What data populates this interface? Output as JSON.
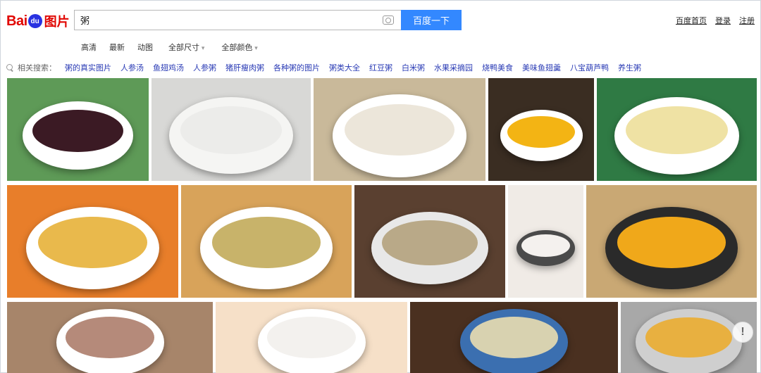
{
  "logo": {
    "bai": "Bai",
    "du": "du",
    "pic": "图片"
  },
  "search": {
    "query": "粥",
    "button": "百度一下"
  },
  "toplinks": [
    "百度首页",
    "登录",
    "注册"
  ],
  "filters": [
    "高清",
    "最新",
    "动图",
    "全部尺寸",
    "全部颜色"
  ],
  "related": {
    "label": "相关搜索：",
    "terms": [
      "粥的真实图片",
      "人参汤",
      "鱼翅鸡汤",
      "人参粥",
      "猪肝瘦肉粥",
      "各种粥的图片",
      "粥类大全",
      "红豆粥",
      "白米粥",
      "水果采摘园",
      "烧鸭美食",
      "美味鱼翅羹",
      "八宝葫芦鸭",
      "养生粥"
    ]
  },
  "help": "!",
  "images": [
    {
      "name": "black-rice-porridge",
      "bg": "#5e9a57",
      "bowl": "#ffffff",
      "food": "#3b1a24"
    },
    {
      "name": "white-rice-porridge",
      "bg": "#d8d8d6",
      "bowl": "#f5f5f3",
      "food": "#ececea"
    },
    {
      "name": "mushroom-rice-porridge",
      "bg": "#c9b99a",
      "bowl": "#ffffff",
      "food": "#ece6da"
    },
    {
      "name": "millet-date-porridge",
      "bg": "#3a2d22",
      "bowl": "#ffffff",
      "food": "#f3b414"
    },
    {
      "name": "yellow-millet-porridge",
      "bg": "#2f7a44",
      "bowl": "#ffffff",
      "food": "#efe2a4"
    },
    {
      "name": "corn-porridge",
      "bg": "#e87e2a",
      "bowl": "#ffffff",
      "food": "#e9b94c"
    },
    {
      "name": "seafood-congee",
      "bg": "#d8a35a",
      "bowl": "#ffffff",
      "food": "#c8b36a"
    },
    {
      "name": "grain-porridge",
      "bg": "#5a4030",
      "bowl": "#e8e8e8",
      "food": "#b9a988"
    },
    {
      "name": "date-milk-porridge",
      "bg": "#f0ebe6",
      "bowl": "#4a4a4a",
      "food": "#f4f1ee"
    },
    {
      "name": "pumpkin-millet-porridge",
      "bg": "#c9a874",
      "bowl": "#2a2a2a",
      "food": "#f0a81a"
    },
    {
      "name": "mixed-bean-porridge",
      "bg": "#a7856a",
      "bowl": "#ffffff",
      "food": "#b58a7a"
    },
    {
      "name": "fruit-porridge",
      "bg": "#f6e0c8",
      "bowl": "#ffffff",
      "food": "#f3f1ee"
    },
    {
      "name": "mung-bean-porridge",
      "bg": "#4a3020",
      "bowl": "#3b6fb0",
      "food": "#d8d2b0"
    },
    {
      "name": "golden-millet-porridge",
      "bg": "#a8a8a8",
      "bowl": "#cfcfcf",
      "food": "#e8b040"
    }
  ]
}
